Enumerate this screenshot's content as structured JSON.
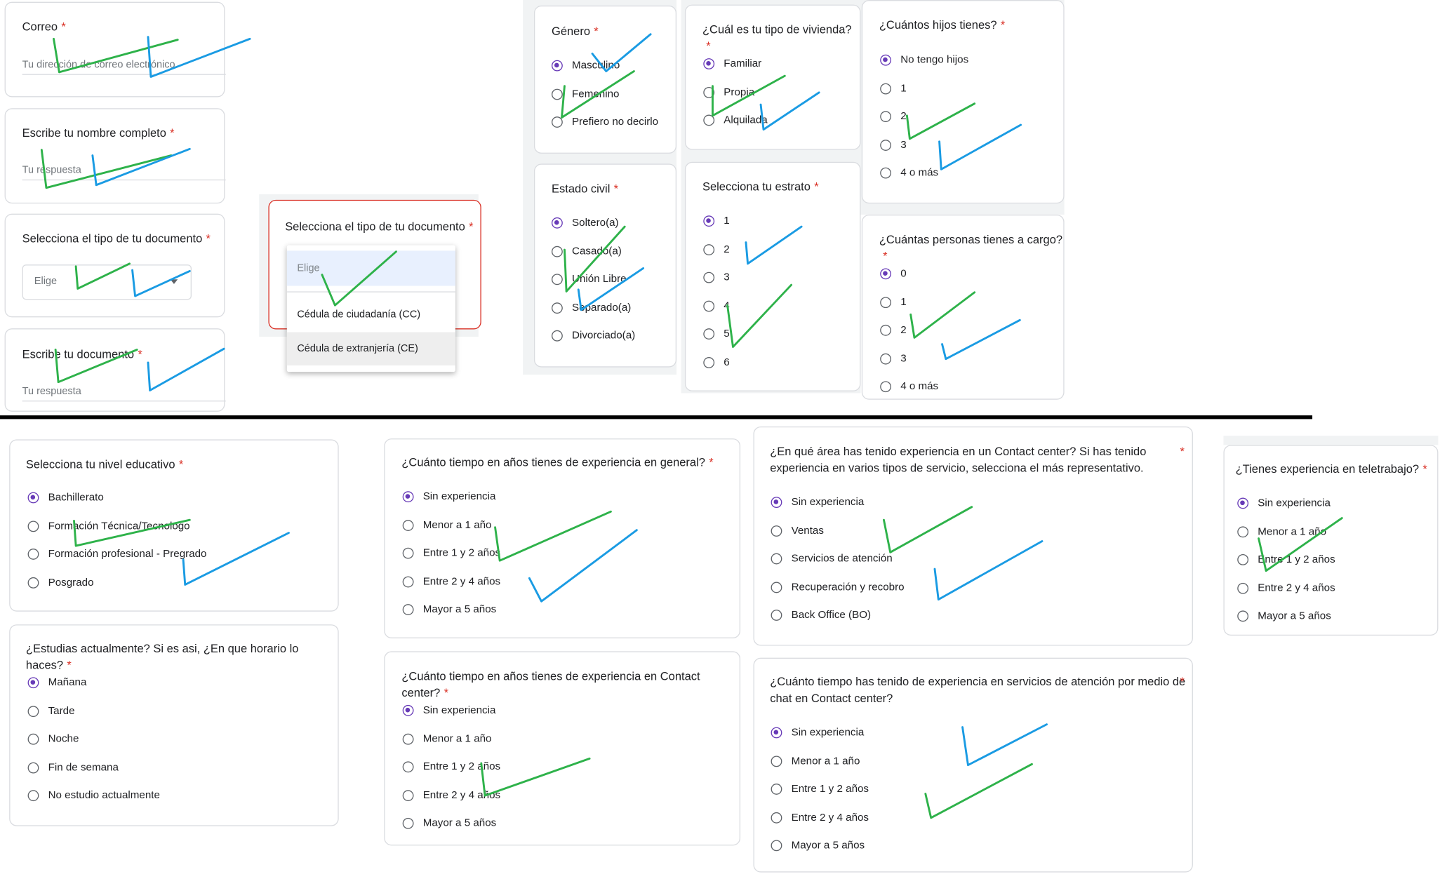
{
  "required_mark": "*",
  "colors": {
    "accent": "#673ab7",
    "required": "#d93025",
    "mark_green": "#2eb24a",
    "mark_blue": "#1a9be3"
  },
  "correo": {
    "label": "Correo",
    "placeholder": "Tu dirección de correo electrónico"
  },
  "nombre": {
    "label": "Escribe tu nombre completo",
    "placeholder": "Tu respuesta"
  },
  "tipo_doc": {
    "label": "Selecciona el tipo de tu documento",
    "value": "Elige"
  },
  "documento": {
    "label": "Escribe tu documento",
    "placeholder": "Tu respuesta"
  },
  "tipo_doc_menu": {
    "label": "Selecciona el tipo de tu documento",
    "options": [
      "Elige",
      "Cédula de ciudadanía (CC)",
      "Cédula de extranjería (CE)"
    ]
  },
  "genero": {
    "label": "Género",
    "options": [
      "Masculino",
      "Femenino",
      "Prefiero no decirlo"
    ],
    "selected": 0
  },
  "vivienda": {
    "label": "¿Cuál es tu tipo de vivienda?",
    "options": [
      "Familiar",
      "Propia",
      "Alquilada"
    ],
    "selected": 0
  },
  "hijos": {
    "label": "¿Cuántos hijos tienes?",
    "options": [
      "No tengo hijos",
      "1",
      "2",
      "3",
      "4 o más"
    ],
    "selected": 0
  },
  "estado_civil": {
    "label": "Estado civil",
    "options": [
      "Soltero(a)",
      "Casado(a)",
      "Unión Libre",
      "Separado(a)",
      "Divorciado(a)"
    ],
    "selected": 0
  },
  "estrato": {
    "label": "Selecciona tu estrato",
    "options": [
      "1",
      "2",
      "3",
      "4",
      "5",
      "6"
    ],
    "selected": 0
  },
  "personas_cargo": {
    "label": "¿Cuántas personas tienes a cargo?",
    "options": [
      "0",
      "1",
      "2",
      "3",
      "4 o más"
    ],
    "selected": 0
  },
  "nivel_educativo": {
    "label": "Selecciona tu nivel educativo",
    "options": [
      "Bachillerato",
      "Formación Técnica/Tecnologo",
      "Formación profesional - Pregrado",
      "Posgrado"
    ],
    "selected": 0
  },
  "estudias": {
    "label": "¿Estudias actualmente? Si es asi, ¿En que horario lo haces?",
    "options": [
      "Mañana",
      "Tarde",
      "Noche",
      "Fin de semana",
      "No estudio actualmente"
    ],
    "selected": 0
  },
  "exp_general": {
    "label": "¿Cuánto tiempo en años tienes de experiencia en general?",
    "options": [
      "Sin experiencia",
      "Menor a 1 año",
      "Entre 1 y 2 años",
      "Entre 2 y 4 años",
      "Mayor a 5 años"
    ],
    "selected": 0
  },
  "exp_contact": {
    "label": "¿Cuánto tiempo en años tienes de experiencia en Contact center?",
    "options": [
      "Sin experiencia",
      "Menor a 1 año",
      "Entre 1 y 2 años",
      "Entre 2 y 4 años",
      "Mayor a 5 años"
    ],
    "selected": 0
  },
  "area_exp": {
    "label_line1": "¿En qué área has tenido experiencia en un Contact center? Si has tenido",
    "label_line2": "experiencia en varios tipos de servicio, selecciona el más representativo.",
    "options": [
      "Sin experiencia",
      "Ventas",
      "Servicios de atención",
      "Recuperación y recobro",
      "Back Office (BO)"
    ],
    "selected": 0
  },
  "exp_chat": {
    "label_line1": "¿Cuánto tiempo has tenido de experiencia en servicios de atención por medio de",
    "label_line2": "chat en Contact center?",
    "options": [
      "Sin experiencia",
      "Menor a 1 año",
      "Entre 1 y 2 años",
      "Entre 2 y 4 años",
      "Mayor a 5 años"
    ],
    "selected": 0
  },
  "teletrabajo": {
    "label": "¿Tienes experiencia en teletrabajo?",
    "options": [
      "Sin experiencia",
      "Menor a 1 año",
      "Entre 1 y 2 años",
      "Entre 2 y 4 años",
      "Mayor a 5 años"
    ],
    "selected": 0
  }
}
